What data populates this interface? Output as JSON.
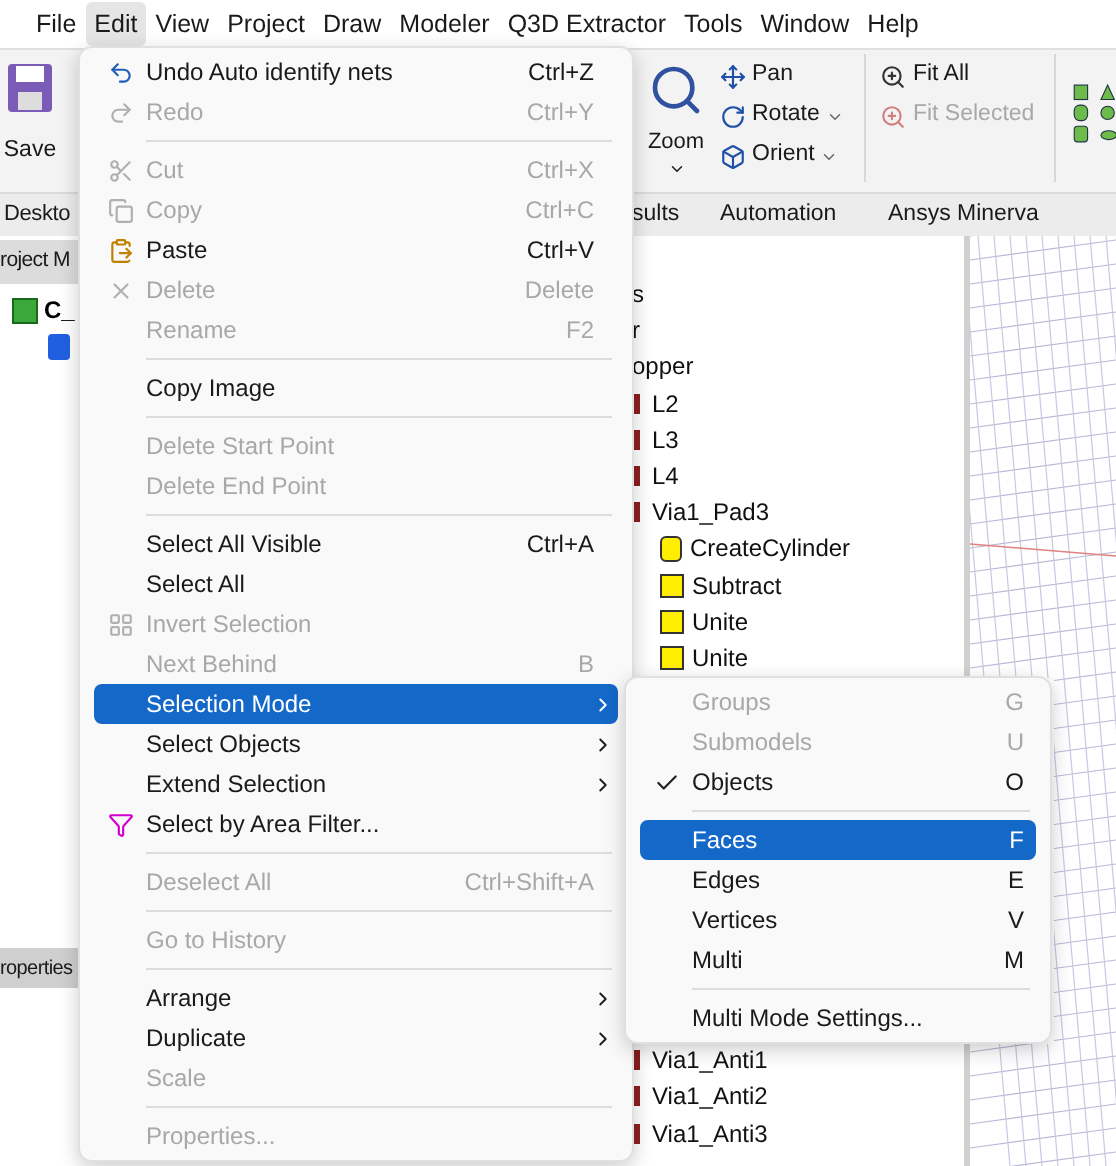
{
  "menu_bar": [
    {
      "label": "File",
      "selected": false
    },
    {
      "label": "Edit",
      "selected": true
    },
    {
      "label": "View",
      "selected": false
    },
    {
      "label": "Project",
      "selected": false
    },
    {
      "label": "Draw",
      "selected": false
    },
    {
      "label": "Modeler",
      "selected": false
    },
    {
      "label": "Q3D Extractor",
      "selected": false
    },
    {
      "label": "Tools",
      "selected": false
    },
    {
      "label": "Window",
      "selected": false
    },
    {
      "label": "Help",
      "selected": false
    }
  ],
  "ribbon": {
    "save": "Save",
    "zoom": "Zoom",
    "view_tools": [
      {
        "label": "Pan",
        "dropdown": false
      },
      {
        "label": "Rotate",
        "dropdown": true
      },
      {
        "label": "Orient",
        "dropdown": true
      }
    ],
    "fit_tools": [
      {
        "label": "Fit All",
        "disabled": false
      },
      {
        "label": "Fit Selected",
        "disabled": true
      }
    ]
  },
  "ribbon_tabs": [
    "Deskto",
    "sults",
    "Automation",
    "Ansys Minerva"
  ],
  "project_manager": {
    "title": "roject M",
    "root": "C_",
    "properties_tab": "roperties"
  },
  "model_tree": [
    "s",
    "r",
    "opper",
    "L2",
    "L3",
    "L4",
    "Via1_Pad3",
    "CreateCylinder",
    "Subtract",
    "Unite",
    "Unite",
    "Via1_Anti1",
    "Via1_Anti2",
    "Via1_Anti3"
  ],
  "edit_menu": [
    [
      {
        "label": "Undo Auto identify nets",
        "shortcut": "Ctrl+Z",
        "disabled": false,
        "submenu": false,
        "selected": false
      },
      {
        "label": "Redo",
        "shortcut": "Ctrl+Y",
        "disabled": true,
        "submenu": false,
        "selected": false
      }
    ],
    [
      {
        "label": "Cut",
        "shortcut": "Ctrl+X",
        "disabled": true,
        "submenu": false,
        "selected": false
      },
      {
        "label": "Copy",
        "shortcut": "Ctrl+C",
        "disabled": true,
        "submenu": false,
        "selected": false
      },
      {
        "label": "Paste",
        "shortcut": "Ctrl+V",
        "disabled": false,
        "submenu": false,
        "selected": false
      },
      {
        "label": "Delete",
        "shortcut": "Delete",
        "disabled": true,
        "submenu": false,
        "selected": false
      },
      {
        "label": "Rename",
        "shortcut": "F2",
        "disabled": true,
        "submenu": false,
        "selected": false
      }
    ],
    [
      {
        "label": "Copy Image",
        "disabled": false,
        "submenu": false,
        "selected": false
      }
    ],
    [
      {
        "label": "Delete Start Point",
        "disabled": true,
        "submenu": false,
        "selected": false
      },
      {
        "label": "Delete End Point",
        "disabled": true,
        "submenu": false,
        "selected": false
      }
    ],
    [
      {
        "label": "Select All Visible",
        "shortcut": "Ctrl+A",
        "disabled": false,
        "submenu": false,
        "selected": false
      },
      {
        "label": "Select All",
        "disabled": false,
        "submenu": false,
        "selected": false
      },
      {
        "label": "Invert Selection",
        "disabled": true,
        "submenu": false,
        "selected": false
      },
      {
        "label": "Next Behind",
        "shortcut": "B",
        "disabled": true,
        "submenu": false,
        "selected": false
      },
      {
        "label": "Selection Mode",
        "disabled": false,
        "submenu": true,
        "selected": true
      },
      {
        "label": "Select Objects",
        "disabled": false,
        "submenu": true,
        "selected": false
      },
      {
        "label": "Extend Selection",
        "disabled": false,
        "submenu": true,
        "selected": false
      },
      {
        "label": "Select by Area Filter...",
        "disabled": false,
        "submenu": false,
        "selected": false
      }
    ],
    [
      {
        "label": "Deselect All",
        "shortcut": "Ctrl+Shift+A",
        "disabled": true,
        "submenu": false,
        "selected": false
      }
    ],
    [
      {
        "label": "Go to History",
        "disabled": true,
        "submenu": false,
        "selected": false
      }
    ],
    [
      {
        "label": "Arrange",
        "disabled": false,
        "submenu": true,
        "selected": false
      },
      {
        "label": "Duplicate",
        "disabled": false,
        "submenu": true,
        "selected": false
      },
      {
        "label": "Scale",
        "disabled": true,
        "submenu": false,
        "selected": false
      }
    ],
    [
      {
        "label": "Properties...",
        "disabled": true,
        "submenu": false,
        "selected": false
      }
    ]
  ],
  "selection_mode_menu": [
    [
      {
        "label": "Groups",
        "shortcut": "G",
        "disabled": true,
        "checked": false,
        "selected": false
      },
      {
        "label": "Submodels",
        "shortcut": "U",
        "disabled": true,
        "checked": false,
        "selected": false
      },
      {
        "label": "Objects",
        "shortcut": "O",
        "disabled": false,
        "checked": true,
        "selected": false
      }
    ],
    [
      {
        "label": "Faces",
        "shortcut": "F",
        "disabled": false,
        "checked": false,
        "selected": true
      },
      {
        "label": "Edges",
        "shortcut": "E",
        "disabled": false,
        "checked": false,
        "selected": false
      },
      {
        "label": "Vertices",
        "shortcut": "V",
        "disabled": false,
        "checked": false,
        "selected": false
      },
      {
        "label": "Multi",
        "shortcut": "M",
        "disabled": false,
        "checked": false,
        "selected": false
      }
    ],
    [
      {
        "label": "Multi Mode Settings...",
        "disabled": false,
        "checked": false,
        "selected": false
      }
    ]
  ]
}
